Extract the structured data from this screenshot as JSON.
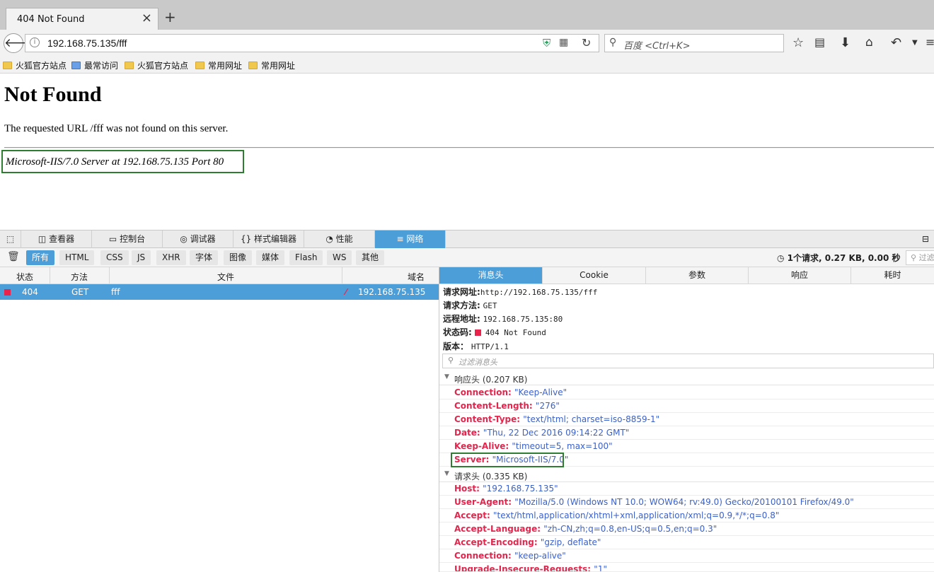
{
  "browser": {
    "tab_title": "404 Not Found",
    "url": "192.168.75.135/fff",
    "search_placeholder": "百度 <Ctrl+K>",
    "bookmarks": [
      "火狐官方站点",
      "最常访问",
      "火狐官方站点",
      "常用网址",
      "常用网址"
    ]
  },
  "page": {
    "heading": "Not Found",
    "message": "The requested URL /fff was not found on this server.",
    "address": "Microsoft-IIS/7.0 Server at 192.168.75.135 Port 80"
  },
  "devtools": {
    "tabs": [
      "查看器",
      "控制台",
      "调试器",
      "样式编辑器",
      "性能",
      "网络"
    ],
    "tab_icons": [
      "inspector-icon",
      "console-icon",
      "debugger-icon",
      "style-editor-icon",
      "performance-icon",
      "network-icon"
    ],
    "filters": [
      "所有",
      "HTML",
      "CSS",
      "JS",
      "XHR",
      "字体",
      "图像",
      "媒体",
      "Flash",
      "WS",
      "其他"
    ],
    "summary": "1个请求, 0.27 KB, 0.00 秒",
    "filter_placeholder": "过滤",
    "columns": [
      "状态",
      "方法",
      "文件",
      "域名"
    ],
    "request": {
      "status": "404",
      "method": "GET",
      "file": "fff",
      "domain": "192.168.75.135"
    },
    "detail_tabs": [
      "消息头",
      "Cookie",
      "参数",
      "响应",
      "耗时"
    ],
    "summary_rows": [
      {
        "label": "请求网址:",
        "value": "http://192.168.75.135/fff"
      },
      {
        "label": "请求方法:",
        "value": "GET"
      },
      {
        "label": "远程地址:",
        "value": "192.168.75.135:80"
      },
      {
        "label": "状态码:",
        "value": "404 Not Found"
      },
      {
        "label": "版本：",
        "value": "HTTP/1.1"
      }
    ],
    "header_filter_placeholder": "过滤消息头",
    "response_section": "响应头 (0.207 KB)",
    "response_headers": [
      {
        "name": "Connection:",
        "value": "\"Keep-Alive\""
      },
      {
        "name": "Content-Length:",
        "value": "\"276\""
      },
      {
        "name": "Content-Type:",
        "value": "\"text/html; charset=iso-8859-1\""
      },
      {
        "name": "Date:",
        "value": "\"Thu, 22 Dec 2016 09:14:22 GMT\""
      },
      {
        "name": "Keep-Alive:",
        "value": "\"timeout=5, max=100\""
      },
      {
        "name": "Server:",
        "value": "\"Microsoft-IIS/7.0\""
      }
    ],
    "request_section": "请求头 (0.335 KB)",
    "request_headers": [
      {
        "name": "Host:",
        "value": "\"192.168.75.135\""
      },
      {
        "name": "User-Agent:",
        "value": "\"Mozilla/5.0 (Windows NT 10.0; WOW64; rv:49.0) Gecko/20100101 Firefox/49.0\""
      },
      {
        "name": "Accept:",
        "value": "\"text/html,application/xhtml+xml,application/xml;q=0.9,*/*;q=0.8\""
      },
      {
        "name": "Accept-Language:",
        "value": "\"zh-CN,zh;q=0.8,en-US;q=0.5,en;q=0.3\""
      },
      {
        "name": "Accept-Encoding:",
        "value": "\"gzip, deflate\""
      },
      {
        "name": "Connection:",
        "value": "\"keep-alive\""
      },
      {
        "name": "Upgrade-Insecure-Requests:",
        "value": "\"1\""
      }
    ]
  },
  "colors": {
    "accent": "#4c9ed9",
    "error": "#e8244d",
    "highlight_box": "#2e7d32",
    "header_name": "#e2264d",
    "header_value": "#3b61c9"
  }
}
